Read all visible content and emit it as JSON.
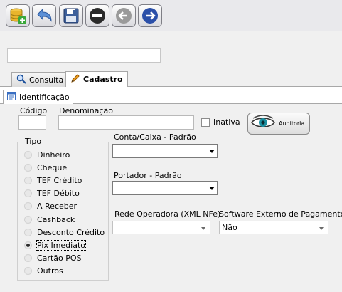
{
  "toolbar": {
    "buttons": [
      {
        "icon": "database-add-icon"
      },
      {
        "icon": "undo-icon"
      },
      {
        "icon": "save-icon"
      },
      {
        "icon": "minus-icon"
      },
      {
        "icon": "arrow-left-icon"
      },
      {
        "icon": "arrow-right-icon"
      }
    ]
  },
  "top_field": {
    "value": ""
  },
  "tabs": [
    {
      "label": "Consulta",
      "icon": "search-icon"
    },
    {
      "label": "Cadastro",
      "icon": "pencil-icon"
    }
  ],
  "subtab": {
    "label": "Identificação",
    "icon": "document-icon"
  },
  "form": {
    "codigo_label": "Código",
    "codigo_value": "",
    "denominacao_label": "Denominação",
    "denominacao_value": "",
    "inativa_label": "Inativa",
    "auditoria_label": "Auditoria",
    "conta_label": "Conta/Caixa - Padrão",
    "conta_value": "",
    "portador_label": "Portador - Padrão",
    "portador_value": "",
    "rede_label": "Rede Operadora (XML NFe)",
    "rede_value": "",
    "software_label": "Software Externo de Pagamento",
    "software_value": "Não"
  },
  "tipo": {
    "title": "Tipo",
    "options": [
      "Dinheiro",
      "Cheque",
      "TEF Crédito",
      "TEF Débito",
      "A Receber",
      "Cashback",
      "Desconto Crédito",
      "Pix Imediato",
      "Cartão POS",
      "Outros"
    ],
    "selected": "Pix Imediato"
  },
  "colors": {
    "accent": "#2b4fa8",
    "tab_pencil": "#f0a020"
  }
}
